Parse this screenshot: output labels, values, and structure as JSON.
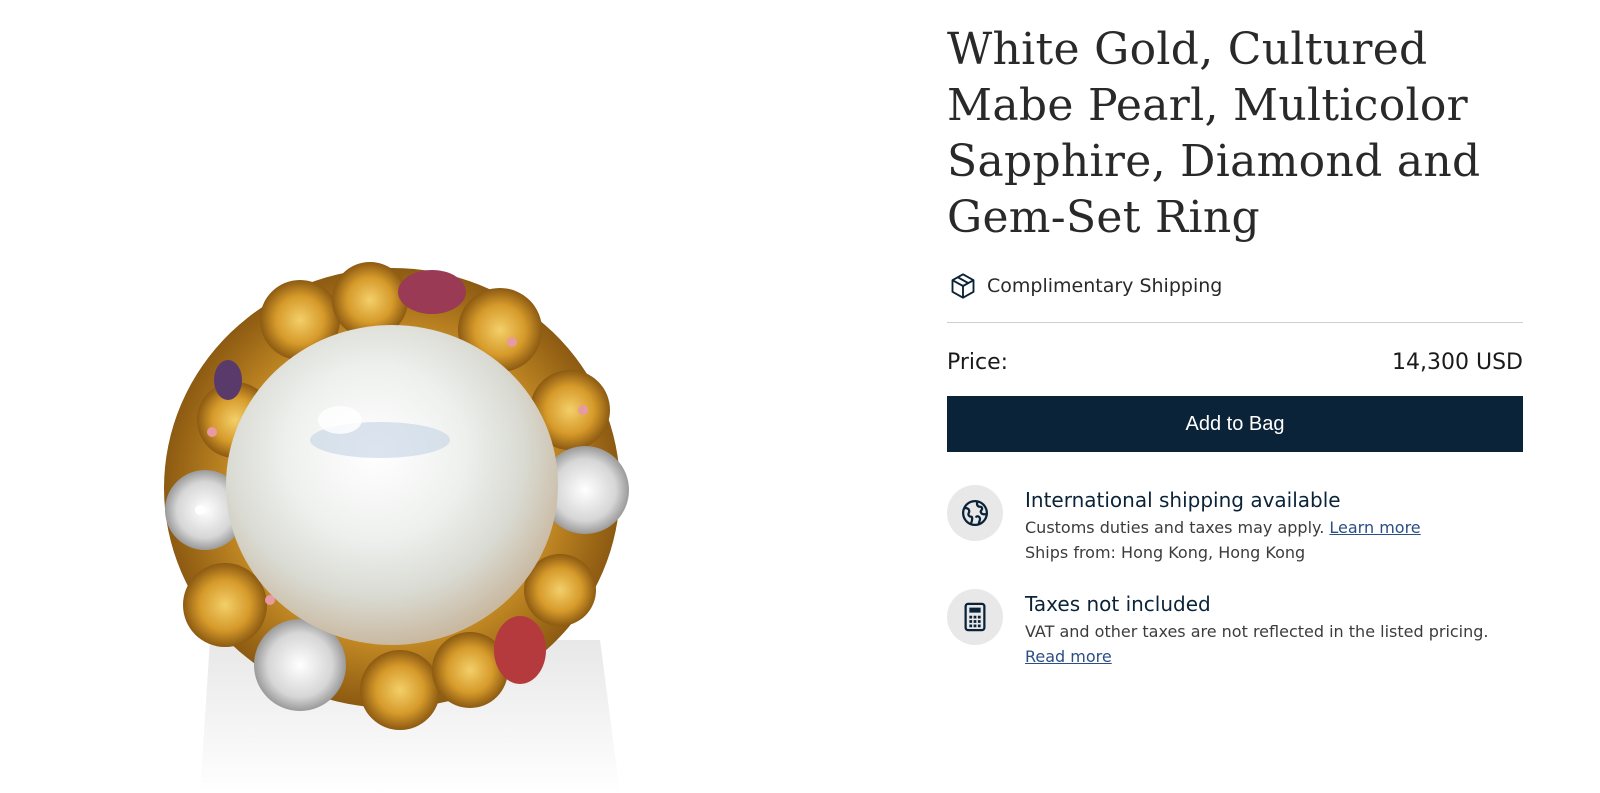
{
  "product": {
    "title": "White Gold, Cultured Mabe Pearl, Multicolor Sapphire, Diamond and Gem-Set Ring",
    "image_alt_icon": "ring-image"
  },
  "shipping": {
    "icon": "package-icon",
    "label": "Complimentary Shipping"
  },
  "price": {
    "label": "Price:",
    "value": "14,300 USD"
  },
  "cta": {
    "add_to_bag": "Add to Bag"
  },
  "info": {
    "international": {
      "icon": "globe-icon",
      "heading": "International shipping available",
      "customs_text": "Customs duties and taxes may apply.",
      "customs_link": "Learn more",
      "ships_from": "Ships from: Hong Kong, Hong Kong"
    },
    "taxes": {
      "icon": "calculator-icon",
      "heading": "Taxes not included",
      "vat_text": "VAT and other taxes are not reflected in the listed pricing.",
      "vat_link": "Read more"
    }
  },
  "colors": {
    "button_bg": "#0b2338",
    "link": "#2b4e86",
    "heading_navy": "#0b2338"
  }
}
